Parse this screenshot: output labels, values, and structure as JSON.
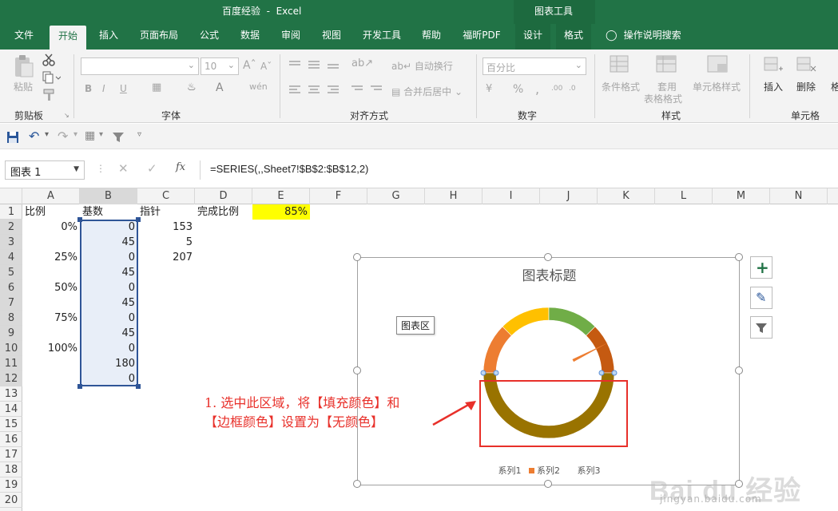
{
  "window": {
    "title": "百度经验  -  Excel",
    "context_tab": "图表工具"
  },
  "tabs": [
    "文件",
    "开始",
    "插入",
    "页面布局",
    "公式",
    "数据",
    "审阅",
    "视图",
    "开发工具",
    "帮助",
    "福昕PDF",
    "设计",
    "格式"
  ],
  "active_tab": "开始",
  "search_label": "操作说明搜索",
  "ribbon": {
    "clipboard": {
      "paste": "粘贴",
      "group": "剪贴板"
    },
    "font": {
      "size": "10",
      "group": "字体"
    },
    "alignment": {
      "wrap": "自动换行",
      "merge": "合并后居中",
      "group": "对齐方式"
    },
    "number": {
      "format": "百分比",
      "group": "数字"
    },
    "styles": {
      "conditional": "条件格式",
      "table1": "套用",
      "table2": "表格格式",
      "cell": "单元格样式",
      "group": "样式"
    },
    "cells": {
      "insert": "插入",
      "delete": "删除",
      "format": "格",
      "group": "单元格"
    }
  },
  "formula_bar": {
    "namebox": "图表 1",
    "fx": "fx",
    "formula": "=SERIES(,,Sheet7!$B$2:$B$12,2)"
  },
  "columns": [
    "A",
    "B",
    "C",
    "D",
    "E",
    "F",
    "G",
    "H",
    "I",
    "J",
    "K",
    "L",
    "M",
    "N"
  ],
  "rows": [
    "1",
    "2",
    "3",
    "4",
    "5",
    "6",
    "7",
    "8",
    "9",
    "10",
    "11",
    "12",
    "13",
    "14",
    "15",
    "16",
    "17",
    "18",
    "19",
    "20"
  ],
  "cells": {
    "A1": "比例",
    "B1": "基数",
    "C1": "指针",
    "D1": "完成比例",
    "E1": "85%",
    "A2": "0%",
    "B2": "0",
    "C2": "153",
    "B3": "45",
    "C3": "5",
    "A4": "25%",
    "B4": "0",
    "C4": "207",
    "B5": "45",
    "A6": "50%",
    "B6": "0",
    "B7": "45",
    "A8": "75%",
    "B8": "0",
    "B9": "45",
    "A10": "100%",
    "B10": "0",
    "B11": "180",
    "B12": "0"
  },
  "chart": {
    "title": "图表标题",
    "tooltip": "图表区",
    "legend": [
      "系列1",
      "系列2",
      "系列3"
    ],
    "colors": {
      "series2": "#ed7d31",
      "selected": "#997300"
    }
  },
  "chart_data": {
    "type": "pie",
    "variant": "doughnut",
    "title": "图表标题",
    "series": [
      {
        "name": "系列2",
        "values": [
          0,
          45,
          0,
          45,
          0,
          45,
          0,
          45,
          0,
          180,
          0
        ],
        "colors": [
          "#ed7d31",
          "#ed7d31",
          "#ffc000",
          "#ffc000",
          "#70ad47",
          "#70ad47",
          "#c55a11",
          "#c55a11",
          "#9e480e",
          "#997300",
          "#997300"
        ]
      }
    ],
    "legend": [
      "系列1",
      "系列2",
      "系列3"
    ],
    "legend_position": "bottom",
    "needle_percent": 85
  },
  "annotation": {
    "line1": "1. 选中此区域，将【填充颜色】和",
    "line2": "【边框颜色】设置为【无颜色】",
    "color": "#e8302a"
  },
  "watermark": {
    "logo": "Bai du 经验",
    "url": "jingyan.baidu.com"
  }
}
